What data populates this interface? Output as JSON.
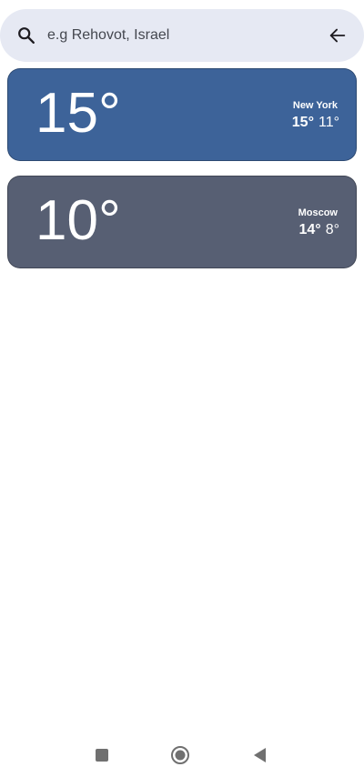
{
  "search": {
    "placeholder": "e.g Rehovot, Israel",
    "value": ""
  },
  "icons": {
    "search": "search-icon",
    "back": "arrow-back-icon"
  },
  "cards": [
    {
      "temp": "15°",
      "city": "New York",
      "high": "15°",
      "low": "11°",
      "color": "#3d6399"
    },
    {
      "temp": "10°",
      "city": "Moscow",
      "high": "14°",
      "low": "8°",
      "color": "#575f73"
    }
  ],
  "nav": {
    "recent": "square-icon",
    "home": "circle-home-icon",
    "back": "triangle-back-icon"
  }
}
